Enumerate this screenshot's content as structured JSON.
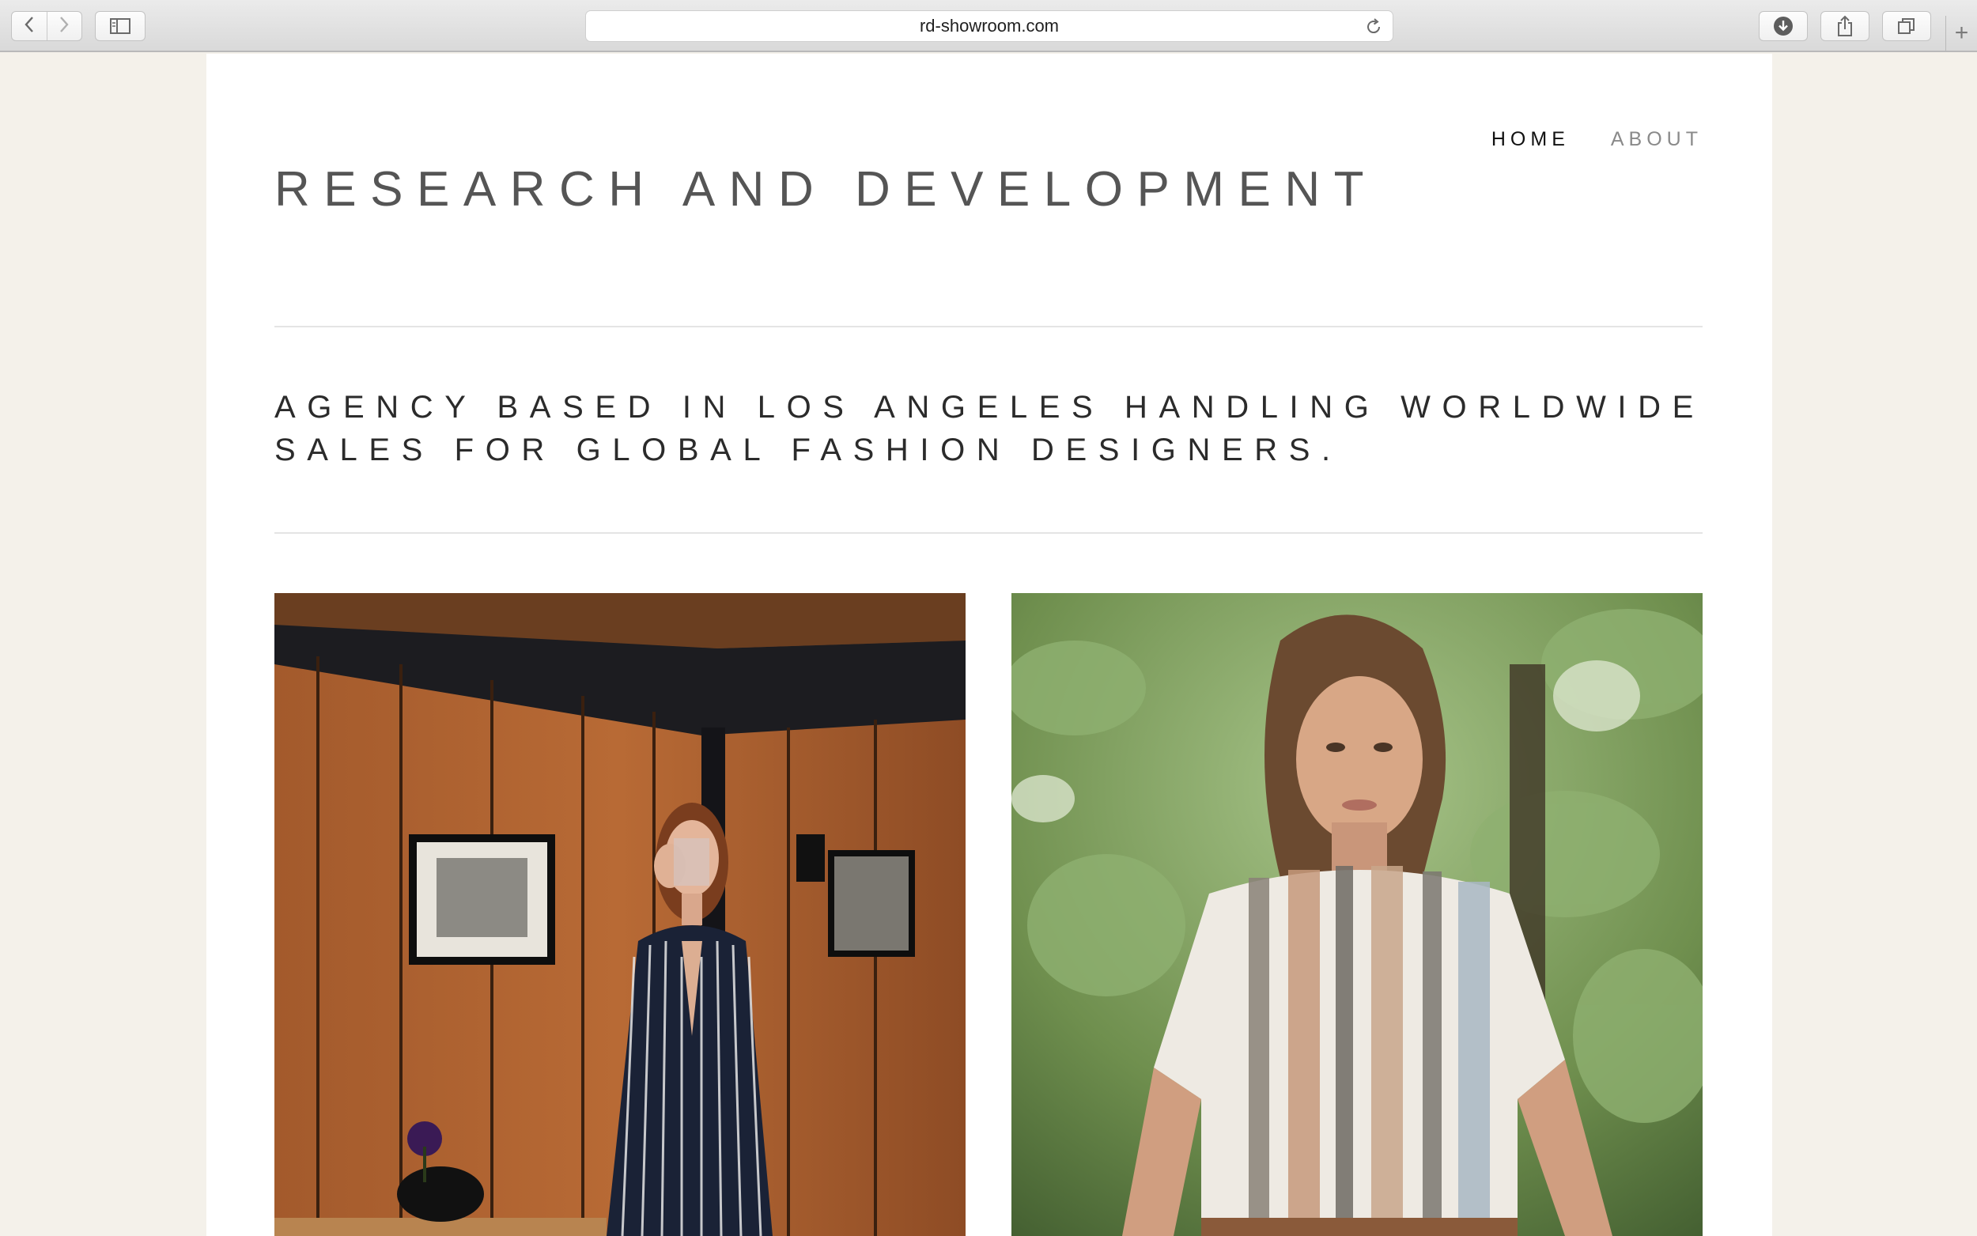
{
  "browser": {
    "url": "rd-showroom.com",
    "icons": {
      "back": "chevron-left-icon",
      "forward": "chevron-right-icon",
      "sidebar": "sidebar-icon",
      "reload": "reload-icon",
      "downloads": "download-icon",
      "share": "share-icon",
      "tabs": "tabs-overview-icon",
      "new_tab": "plus-icon"
    },
    "new_tab_glyph": "+"
  },
  "site": {
    "title": "RESEARCH AND DEVELOPMENT",
    "nav": [
      {
        "label": "HOME",
        "active": true
      },
      {
        "label": "ABOUT",
        "active": false
      }
    ],
    "tagline_lines": [
      "AGENCY BASED IN LOS ANGELES HANDLING WORLDWIDE",
      "SALES FOR GLOBAL FASHION DESIGNERS."
    ]
  },
  "colors": {
    "page_background": "#f4f1ea",
    "content_background": "#ffffff",
    "title_text": "#555555",
    "nav_active": "#111111",
    "nav_inactive": "#8a8a8a",
    "rule": "#e4e4e4"
  }
}
